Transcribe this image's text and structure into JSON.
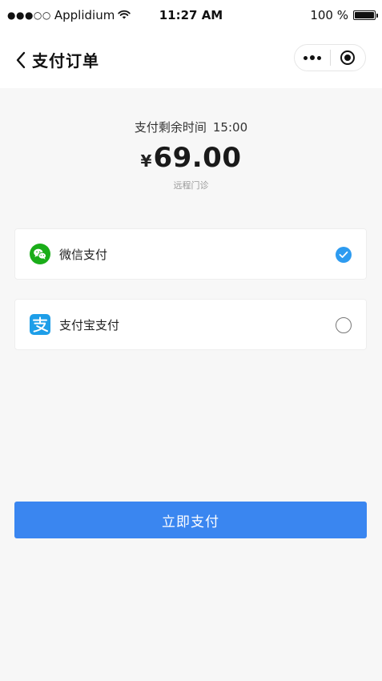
{
  "status_bar": {
    "signal": "●●●○○",
    "carrier": "Applidium",
    "time": "11:27 AM",
    "battery_text": "100 %",
    "battery_level": 1.0
  },
  "nav": {
    "title": "支付订单"
  },
  "payment": {
    "timer_label": "支付剩余时间",
    "timer_value": "15:00",
    "currency_symbol": "¥",
    "amount": "69.00",
    "description": "远程门诊"
  },
  "options": [
    {
      "label": "微信支付",
      "icon": "wechat-icon",
      "selected": true
    },
    {
      "label": "支付宝支付",
      "icon": "alipay-icon",
      "selected": false
    }
  ],
  "pay_button": {
    "label": "立即支付"
  },
  "colors": {
    "accent": "#3a86f0",
    "check": "#2d9bf0",
    "wechat_green": "#1aad19",
    "alipay_blue": "#1e9ee8",
    "background": "#f7f7f7"
  }
}
